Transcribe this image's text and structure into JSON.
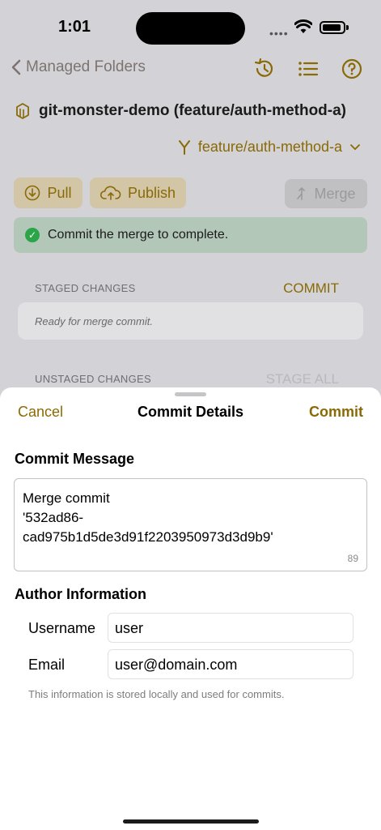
{
  "status_bar": {
    "time": "1:01"
  },
  "nav": {
    "back_label": "Managed Folders",
    "icons": [
      "history-icon",
      "list-icon",
      "help-icon"
    ]
  },
  "repo": {
    "title": "git-monster-demo (feature/auth-method-a)",
    "branch": "feature/auth-method-a"
  },
  "actions": {
    "pull_label": "Pull",
    "publish_label": "Publish",
    "merge_label": "Merge"
  },
  "banner": {
    "text": "Commit the merge to complete."
  },
  "staged": {
    "header": "STAGED CHANGES",
    "action": "COMMIT",
    "placeholder": "Ready for merge commit."
  },
  "unstaged": {
    "header": "UNSTAGED CHANGES",
    "action": "STAGE ALL"
  },
  "sheet": {
    "cancel_label": "Cancel",
    "title": "Commit Details",
    "commit_label": "Commit",
    "message_heading": "Commit Message",
    "message_value": "Merge commit\n'532ad86-\ncad975b1d5de3d91f2203950973d3d9b9'",
    "char_count": "89",
    "author_heading": "Author Information",
    "username_label": "Username",
    "username_value": "user",
    "email_label": "Email",
    "email_value": "user@domain.com",
    "note": "This information is stored locally and used for commits."
  },
  "colors": {
    "accent": "#8a6a05",
    "success": "#2aa548",
    "dim_background": "#d3d3d7"
  }
}
